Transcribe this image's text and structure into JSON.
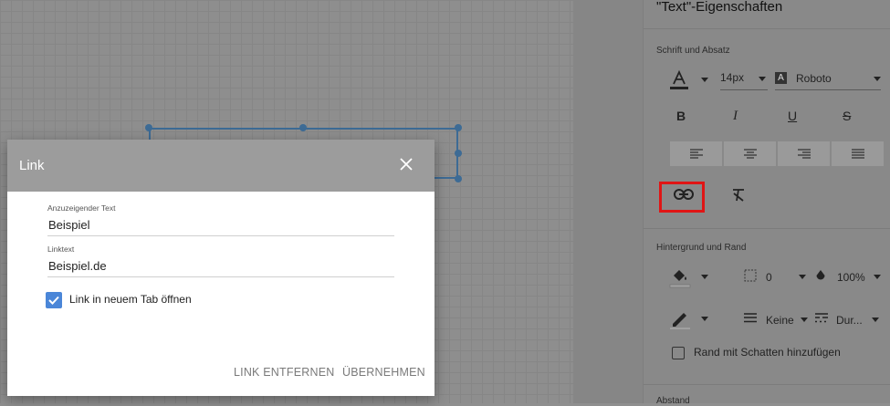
{
  "panel": {
    "title": "\"Text\"-Eigenschaften",
    "section_font": "Schrift und Absatz",
    "font_size": "14px",
    "font_family": "Roboto",
    "section_background": "Hintergrund und Rand",
    "border_radius_value": "0",
    "opacity_value": "100%",
    "border_style": "Keine",
    "border_dash": "Dur...",
    "shadow_label": "Rand mit Schatten hinzufügen",
    "section_spacing": "Abstand"
  },
  "dialog": {
    "title": "Link",
    "display_text_label": "Anzuzeigender Text",
    "display_text_value": "Beispiel",
    "link_label": "Linktext",
    "link_value": "Beispiel.de",
    "new_tab_label": "Link in neuem Tab öffnen",
    "new_tab_checked": true,
    "remove_button": "LINK ENTFERNEN",
    "apply_button": "ÜBERNEHMEN"
  },
  "icons": [
    "text-color-icon",
    "font-icon",
    "bold-icon",
    "italic-icon",
    "underline-icon",
    "strikethrough-icon",
    "align-left-icon",
    "align-center-icon",
    "align-right-icon",
    "align-justify-icon",
    "link-icon",
    "clear-format-icon",
    "fill-color-icon",
    "border-radius-icon",
    "opacity-icon",
    "border-color-icon",
    "border-weight-icon",
    "border-dash-icon",
    "close-icon",
    "checkbox-icon"
  ],
  "colors": {
    "highlight": "#e01515",
    "accent": "#4a86d8",
    "selection": "#3d6b95"
  }
}
